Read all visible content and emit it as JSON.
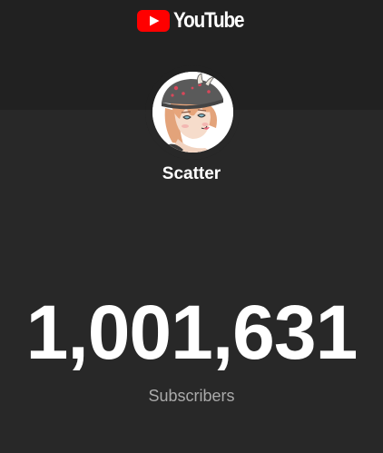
{
  "brand": {
    "name": "YouTube",
    "logo_icon": "youtube-play-logo",
    "logo_color": "#ff0000"
  },
  "channel": {
    "name": "Scatter",
    "avatar_icon": "channel-avatar"
  },
  "stats": {
    "subscriber_count": "1,001,631",
    "subscriber_label": "Subscribers"
  },
  "colors": {
    "background": "#282828",
    "header_band": "#212121",
    "primary_text": "#ffffff",
    "secondary_text": "#aaaaaa"
  }
}
